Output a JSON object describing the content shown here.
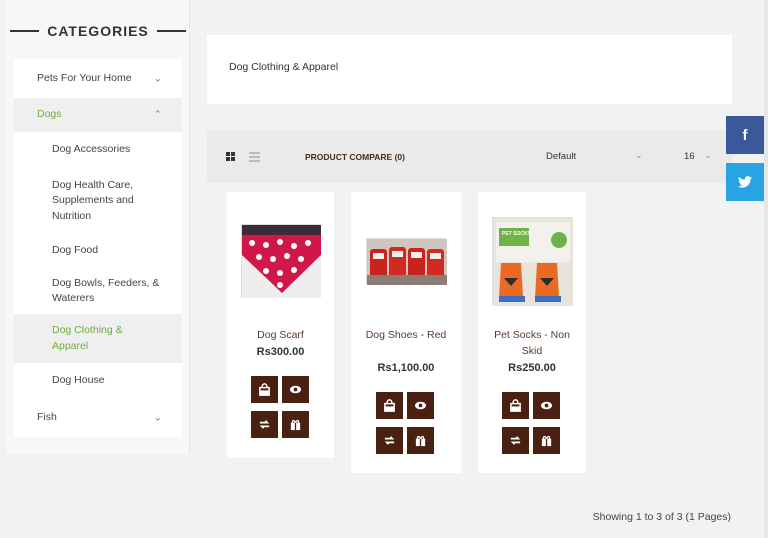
{
  "sidebar": {
    "title": "CATEGORIES",
    "items": [
      {
        "label": "Pets For Your Home",
        "chevron": "chevron-down"
      },
      {
        "label": "Dogs",
        "chevron": "chevron-up"
      },
      {
        "label": "Dog Accessories"
      },
      {
        "label": "Dog Health Care, Supplements and Nutrition"
      },
      {
        "label": "Dog Food"
      },
      {
        "label": "Dog Bowls, Feeders, & Waterers"
      },
      {
        "label": "Dog Clothing & Apparel"
      },
      {
        "label": "Dog House"
      },
      {
        "label": "Fish",
        "chevron": "chevron-down"
      }
    ]
  },
  "header": {
    "title": "Dog Clothing & Apparel"
  },
  "toolbar": {
    "compare_label": "PRODUCT COMPARE (0)",
    "sort_value": "Default",
    "limit_value": "16"
  },
  "social": {
    "facebook": "f",
    "twitter": "🐦"
  },
  "products": [
    {
      "name": "Dog Scarf",
      "price": "Rs300.00"
    },
    {
      "name": "Dog Shoes - Red",
      "price": "Rs1,100.00"
    },
    {
      "name": "Pet Socks - Non Skid",
      "price": "Rs250.00",
      "image_text": "PET SOCKS"
    }
  ],
  "pager": "Showing 1 to 3 of 3 (1 Pages)",
  "colors": {
    "accent": "#6cae3e",
    "button": "#4a2012",
    "facebook": "#3b5998",
    "twitter": "#2aa3e5"
  }
}
